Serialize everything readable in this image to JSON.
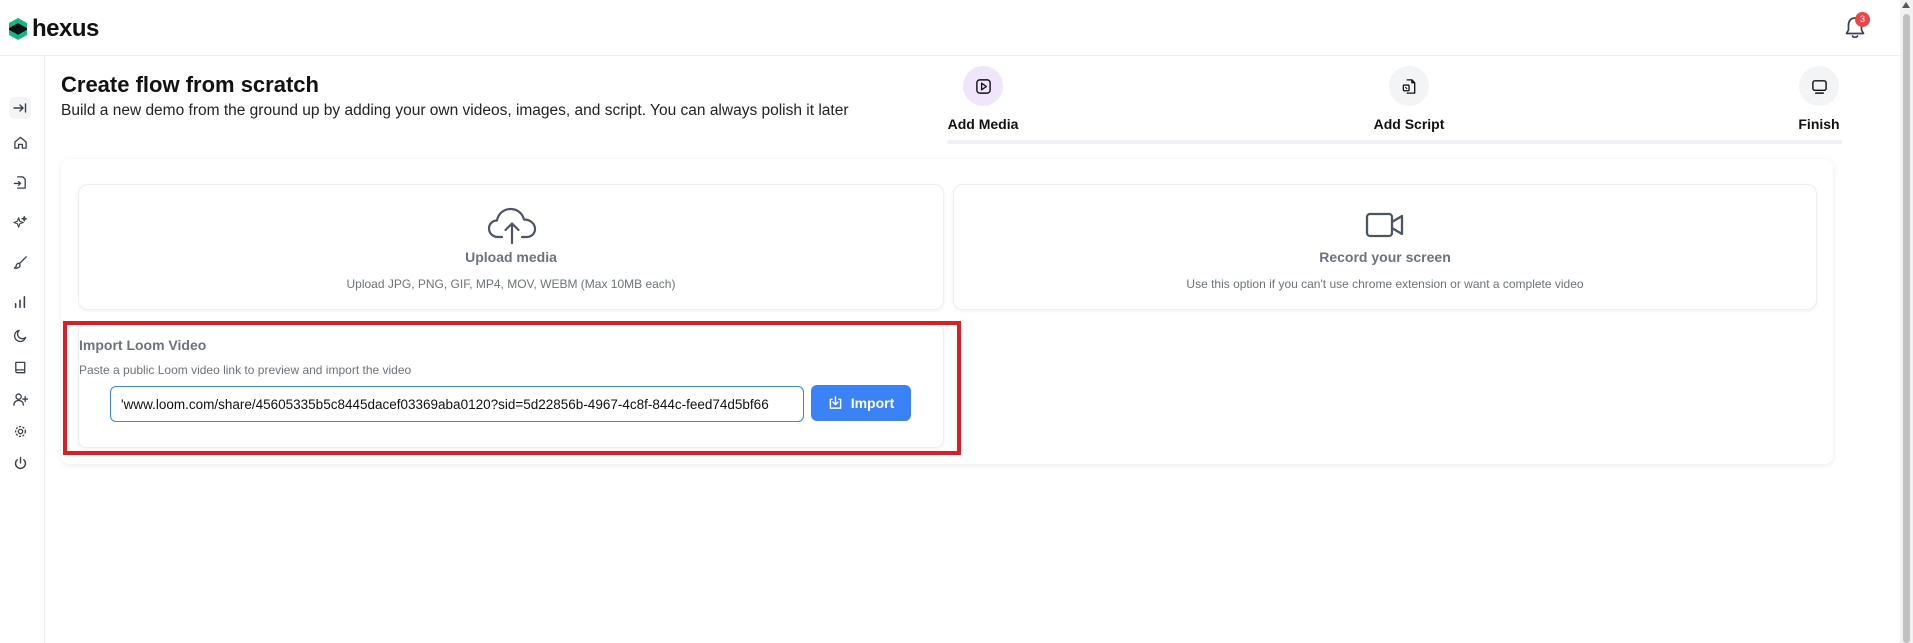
{
  "app": {
    "name": "hexus"
  },
  "header": {
    "notification_count": "3"
  },
  "page": {
    "title": "Create flow from scratch",
    "subtitle": "Build a new demo from the ground up by adding your own videos, images, and script. You can always polish it later"
  },
  "steps": [
    {
      "label": "Add Media",
      "icon": "play-square-icon",
      "active": true
    },
    {
      "label": "Add Script",
      "icon": "script-file-icon",
      "active": false
    },
    {
      "label": "Finish",
      "icon": "monitor-icon",
      "active": false
    }
  ],
  "upload": {
    "title": "Upload media",
    "description": "Upload JPG, PNG, GIF, MP4, MOV, WEBM (Max 10MB each)"
  },
  "record": {
    "title": "Record your screen",
    "description": "Use this option if you can't use chrome extension or want a complete video"
  },
  "loom": {
    "title": "Import Loom Video",
    "description": "Paste a public Loom video link to preview and import the video",
    "input_value": "'www.loom.com/share/45605335b5c8445dacef03369aba0120?sid=5d22856b-4967-4c8f-844c-feed74d5bf66",
    "button_label": "Import"
  },
  "sidebar": {
    "items": [
      {
        "icon": "expand-arrow-icon"
      },
      {
        "icon": "home-icon"
      },
      {
        "icon": "file-import-icon"
      },
      {
        "icon": "sparkles-icon"
      },
      {
        "icon": "brush-icon"
      },
      {
        "icon": "bar-chart-icon"
      },
      {
        "icon": "moon-icon"
      },
      {
        "icon": "book-icon"
      },
      {
        "icon": "user-plus-icon"
      },
      {
        "icon": "gear-icon"
      },
      {
        "icon": "power-icon"
      }
    ]
  },
  "colors": {
    "accent": "#3b82f6",
    "brand_green": "#10b981",
    "highlight_red": "#e11d24",
    "badge_red": "#ef4444",
    "active_step_bg": "#f0e6fb"
  }
}
